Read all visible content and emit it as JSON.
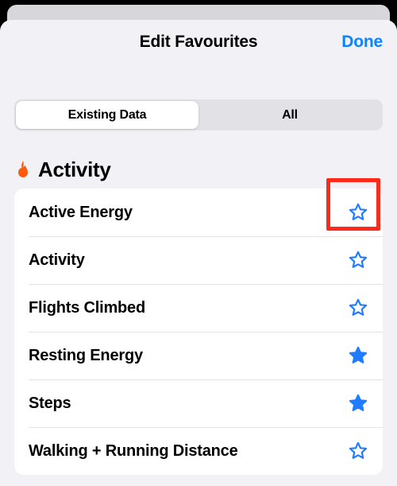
{
  "header": {
    "title": "Edit Favourites",
    "done_label": "Done"
  },
  "segmented": {
    "options": [
      "Existing Data",
      "All"
    ],
    "selected_index": 0
  },
  "section": {
    "icon": "flame-icon",
    "icon_glyph": "🔥",
    "title": "Activity",
    "accent_color": "#ff5a0a"
  },
  "rows": [
    {
      "label": "Active Energy",
      "favourite": false,
      "highlight": true
    },
    {
      "label": "Activity",
      "favourite": false
    },
    {
      "label": "Flights Climbed",
      "favourite": false
    },
    {
      "label": "Resting Energy",
      "favourite": true
    },
    {
      "label": "Steps",
      "favourite": true
    },
    {
      "label": "Walking + Running Distance",
      "favourite": false
    }
  ],
  "colors": {
    "star": "#1f7cff"
  }
}
